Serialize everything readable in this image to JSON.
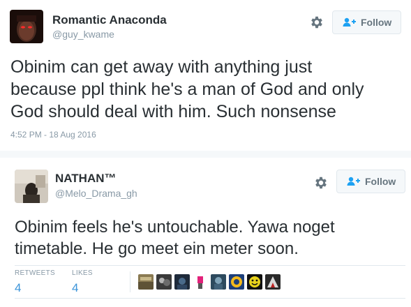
{
  "tweets": [
    {
      "name": "Romantic Anaconda",
      "handle": "@guy_kwame",
      "follow_label": "Follow",
      "text_lines": [
        "Obinim can get away with anything just",
        "because ppl think he's a man of God and only",
        "God should deal with him. Such nonsense"
      ],
      "timestamp": "4:52 PM - 18 Aug 2016"
    },
    {
      "name": "NATHAN™",
      "handle": "@Melo_Drama_gh",
      "follow_label": "Follow",
      "text_lines": [
        "Obinim feels he's untouchable. Yawa noget",
        "timetable. He go meet ein meter soon."
      ],
      "retweets_label": "RETWEETS",
      "retweets_count": "4",
      "likes_label": "LIKES",
      "likes_count": "4",
      "liker_count": 8
    }
  ],
  "icons": {
    "settings": "gear-icon",
    "follow": "add-user-icon"
  },
  "colors": {
    "link_blue": "#3b94d9",
    "follow_icon": "#1da1f2",
    "muted": "#8899a6"
  }
}
